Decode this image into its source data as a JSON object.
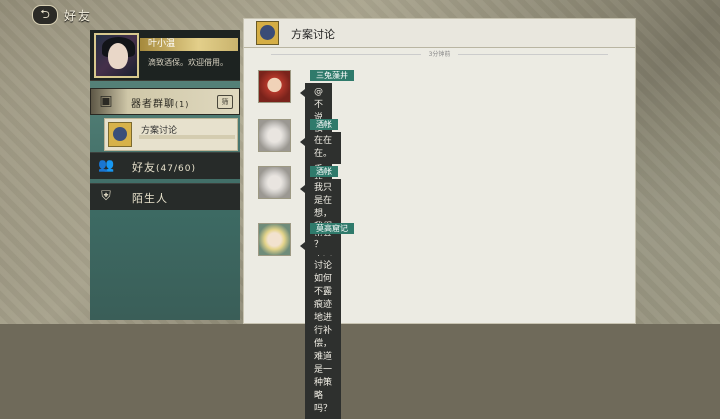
{
  "topbar": {
    "back_glyph": "⮌",
    "title": "好友"
  },
  "profile": {
    "name": "叶小温",
    "signature": "滴致酒保。欢迎借用。"
  },
  "group_section": {
    "label": "器者群聊",
    "count": "(1)",
    "filter_label": "筛"
  },
  "group_items": [
    {
      "name": "方案讨论"
    }
  ],
  "nav_tabs": [
    {
      "label": "好友",
      "count": "(47/60)",
      "icon": "friends-icon"
    },
    {
      "label": "陌生人",
      "icon": "stranger-icon"
    }
  ],
  "chat": {
    "title": "方案讨论",
    "time_separator": "3分钟前",
    "messages": [
      {
        "sender": "三兔藻井",
        "text": "@不说话装高手的账本",
        "avatar": "red"
      },
      {
        "sender": "酒帐",
        "text": "在在在。",
        "avatar": "white"
      },
      {
        "sender": "酒帐",
        "text_line1": "我只是在想，我们当着本人讨论如何不露痕迹地进",
        "text_line2": "行补偿，难道是一种策略吗？",
        "avatar": "white"
      },
      {
        "sender": "莫高窟记",
        "text": "？",
        "avatar": "gold"
      }
    ]
  }
}
